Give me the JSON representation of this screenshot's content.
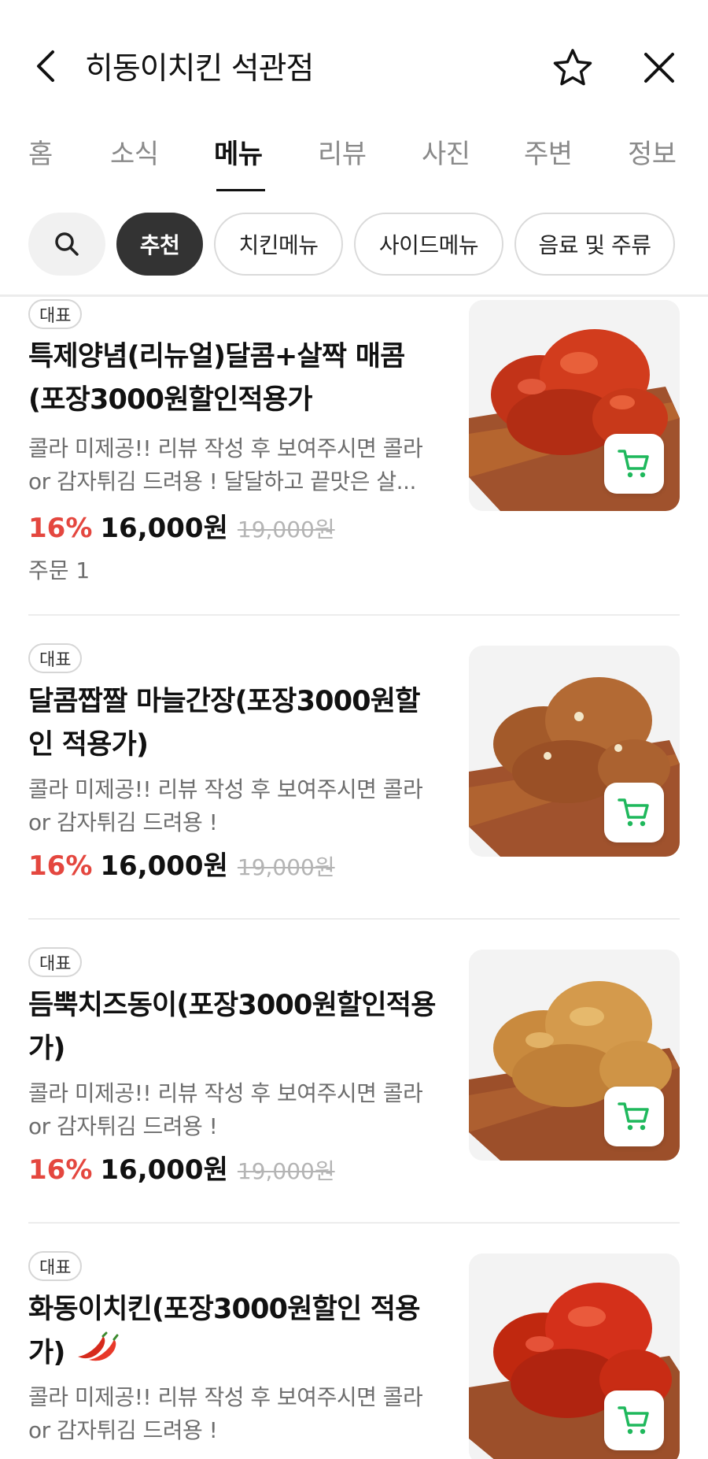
{
  "header": {
    "title": "히동이치킨 석관점"
  },
  "tabs": [
    {
      "label": "홈"
    },
    {
      "label": "소식"
    },
    {
      "label": "메뉴",
      "active": true
    },
    {
      "label": "리뷰"
    },
    {
      "label": "사진"
    },
    {
      "label": "주변"
    },
    {
      "label": "정보"
    }
  ],
  "chips": [
    {
      "label": "추천",
      "selected": true
    },
    {
      "label": "치킨메뉴"
    },
    {
      "label": "사이드메뉴"
    },
    {
      "label": "음료 및 주류"
    }
  ],
  "menu_items": [
    {
      "badge": "대표",
      "name": "특제양념(리뉴얼)달콤+살짝 매콤(포장3000원할인적용가",
      "description": "콜라 미제공!! 리뷰 작성 후 보여주시면 콜라 or 감자튀김 드려용 ! 달달하고 끝맛은 살...",
      "discount": "16%",
      "price": "16,000원",
      "original_price": "19,000원",
      "order_count": "주문 1"
    },
    {
      "badge": "대표",
      "name": "달콤짭짤 마늘간장(포장3000원할인 적용가)",
      "description": "콜라 미제공!! 리뷰 작성 후 보여주시면 콜라 or 감자튀김 드려용 !",
      "discount": "16%",
      "price": "16,000원",
      "original_price": "19,000원"
    },
    {
      "badge": "대표",
      "name": "듬뿍치즈동이(포장3000원할인적용가)",
      "description": "콜라 미제공!! 리뷰 작성 후 보여주시면 콜라 or 감자튀김 드려용 !",
      "discount": "16%",
      "price": "16,000원",
      "original_price": "19,000원"
    },
    {
      "badge": "대표",
      "name": "화동이치킨(포장3000원할인 적용가)",
      "description": "콜라 미제공!! 리뷰 작성 후 보여주시면 콜라 or 감자튀김 드려용 !"
    }
  ],
  "colors": {
    "discount": "#e4473f",
    "cart_icon": "#1fb85c",
    "selected_chip": "#333333"
  },
  "icons": {
    "back": "chevron-left-icon",
    "favorite": "star-outline-icon",
    "close": "close-icon",
    "search": "search-icon",
    "cart": "cart-icon",
    "spicy": "chili-pepper-icon"
  }
}
